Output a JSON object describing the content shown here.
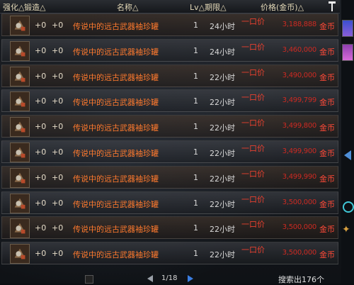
{
  "header": {
    "strength": "强化△",
    "forge": "锻造△",
    "name": "名称△",
    "lv_period": "Lv△期限△",
    "price": "价格(金币)△"
  },
  "rows": [
    {
      "strength": "+0",
      "forge": "+0",
      "name": "传说中的远古武器袖珍罐",
      "lv": "1",
      "period": "24小时",
      "buyout": "一口价",
      "price": "3,188,888",
      "currency": "金币"
    },
    {
      "strength": "+0",
      "forge": "+0",
      "name": "传说中的远古武器袖珍罐",
      "lv": "1",
      "period": "24小时",
      "buyout": "一口价",
      "price": "3,460,000",
      "currency": "金币"
    },
    {
      "strength": "+0",
      "forge": "+0",
      "name": "传说中的远古武器袖珍罐",
      "lv": "1",
      "period": "22小时",
      "buyout": "一口价",
      "price": "3,490,000",
      "currency": "金币"
    },
    {
      "strength": "+0",
      "forge": "+0",
      "name": "传说中的远古武器袖珍罐",
      "lv": "1",
      "period": "22小时",
      "buyout": "一口价",
      "price": "3,499,799",
      "currency": "金币"
    },
    {
      "strength": "+0",
      "forge": "+0",
      "name": "传说中的远古武器袖珍罐",
      "lv": "1",
      "period": "22小时",
      "buyout": "一口价",
      "price": "3,499,800",
      "currency": "金币"
    },
    {
      "strength": "+0",
      "forge": "+0",
      "name": "传说中的远古武器袖珍罐",
      "lv": "1",
      "period": "22小时",
      "buyout": "一口价",
      "price": "3,499,900",
      "currency": "金币"
    },
    {
      "strength": "+0",
      "forge": "+0",
      "name": "传说中的远古武器袖珍罐",
      "lv": "1",
      "period": "22小时",
      "buyout": "一口价",
      "price": "3,499,990",
      "currency": "金币"
    },
    {
      "strength": "+0",
      "forge": "+0",
      "name": "传说中的远古武器袖珍罐",
      "lv": "1",
      "period": "22小时",
      "buyout": "一口价",
      "price": "3,500,000",
      "currency": "金币"
    },
    {
      "strength": "+0",
      "forge": "+0",
      "name": "传说中的远古武器袖珍罐",
      "lv": "1",
      "period": "22小时",
      "buyout": "一口价",
      "price": "3,500,000",
      "currency": "金币"
    },
    {
      "strength": "+0",
      "forge": "+0",
      "name": "传说中的远古武器袖珍罐",
      "lv": "1",
      "period": "22小时",
      "buyout": "一口价",
      "price": "3,500,000",
      "currency": "金币"
    }
  ],
  "pagination": {
    "page": "1/18"
  },
  "results": {
    "count_text": "搜索出176个"
  },
  "icons": {
    "pin": "pin-icon",
    "item": "item-jar-icon",
    "prev": "prev-page-icon",
    "next": "next-page-icon"
  },
  "colors": {
    "item_name": "#ff7a2e",
    "price": "#cc2a22",
    "currency": "#ff4a38",
    "header_text": "#e4d9b8"
  }
}
